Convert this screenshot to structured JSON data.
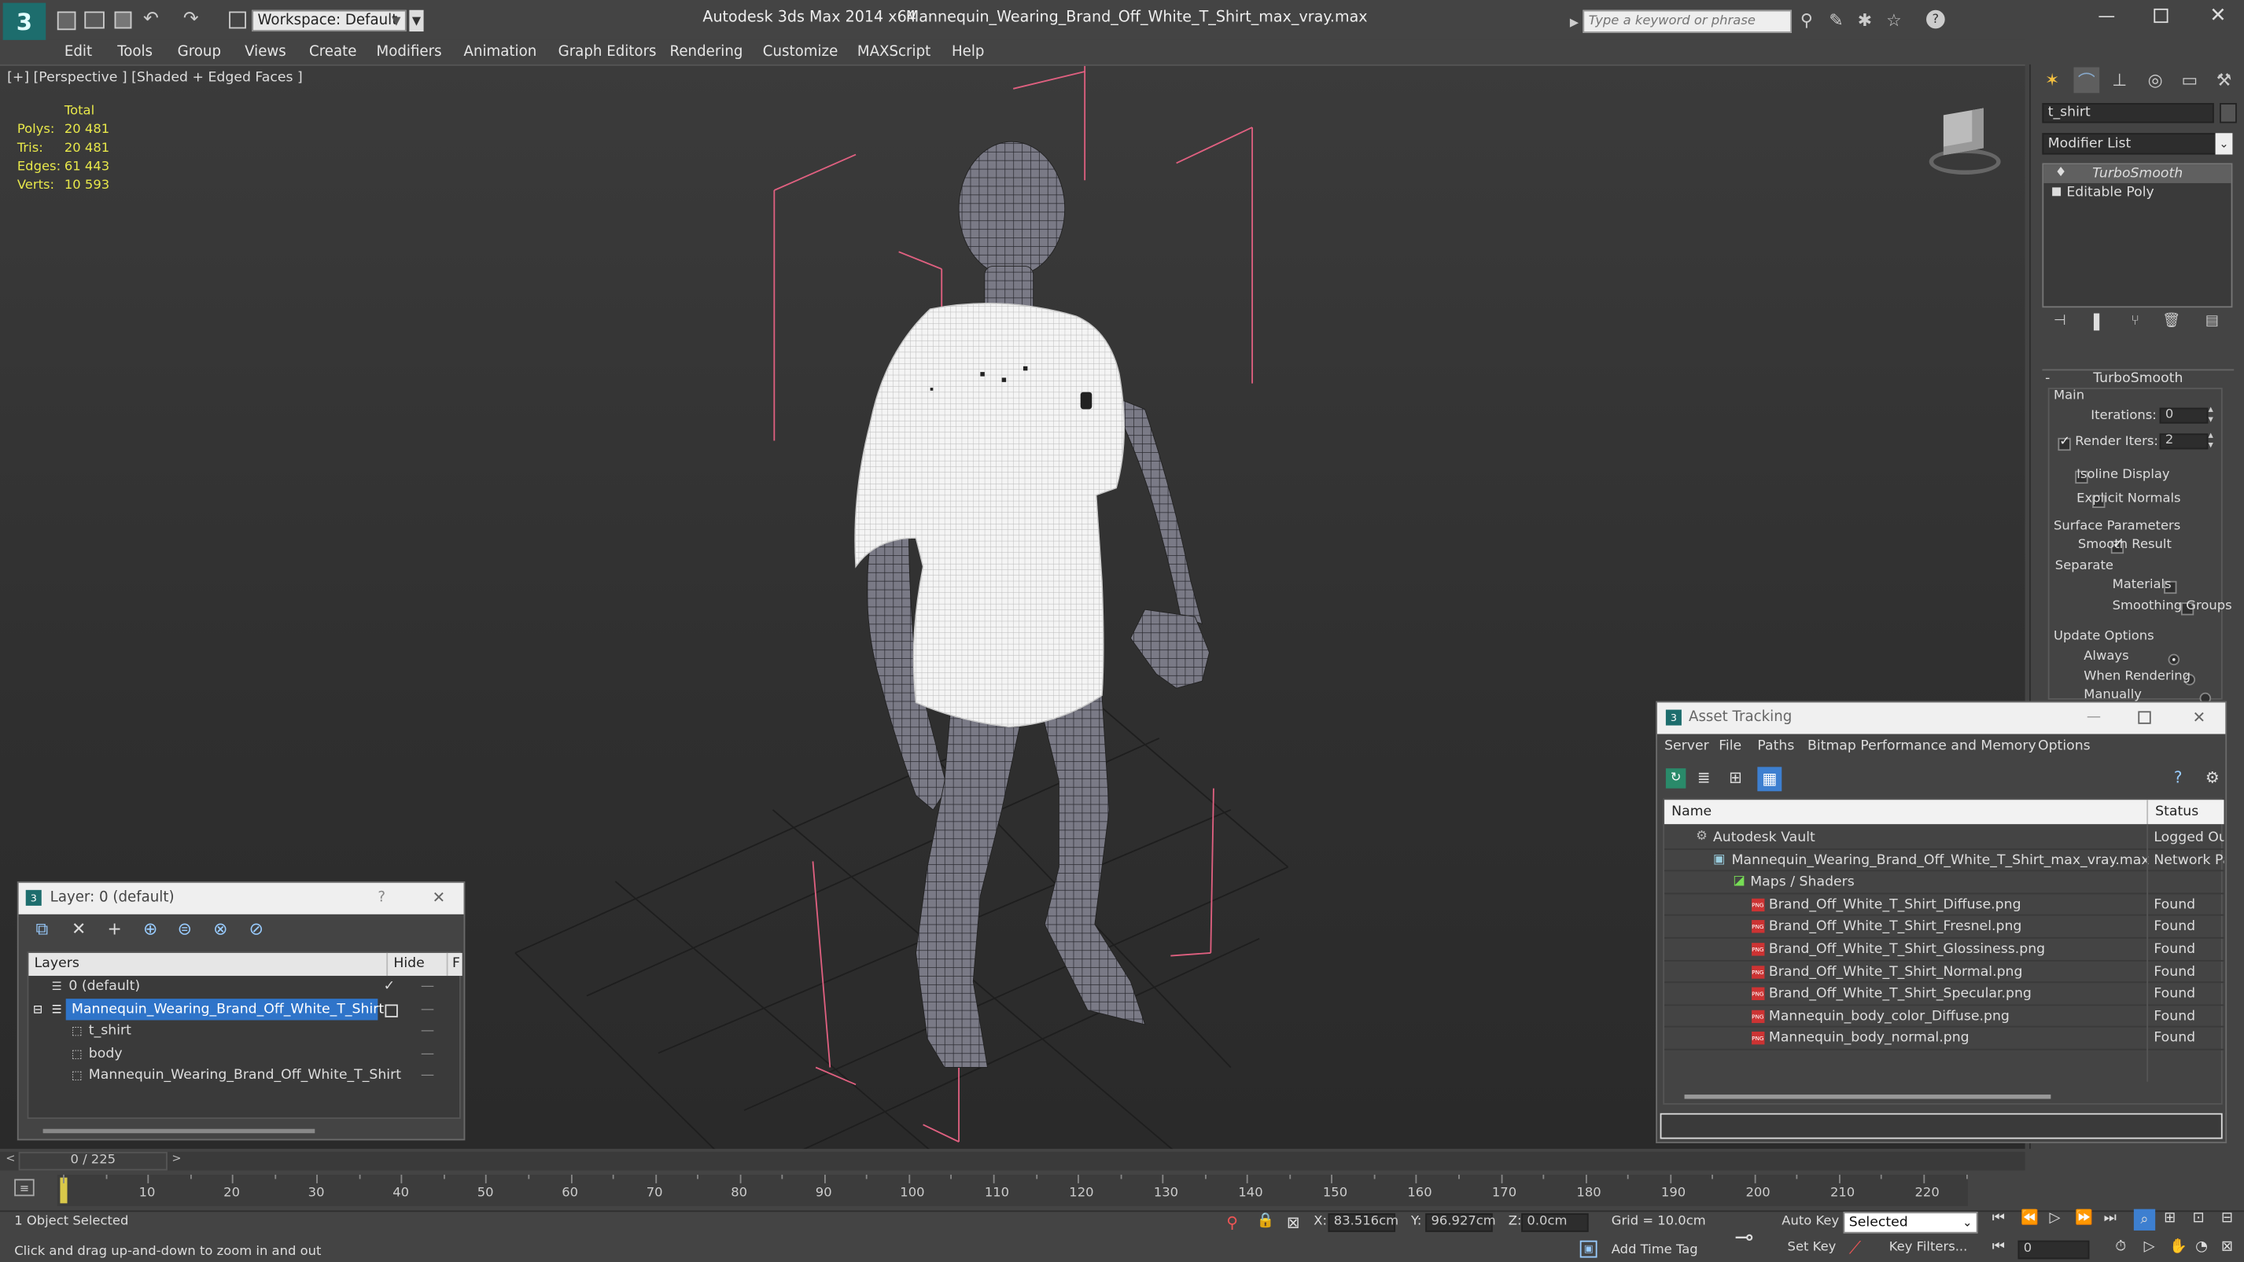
{
  "app": {
    "title": "Autodesk 3ds Max  2014 x64",
    "file": "Mannequin_Wearing_Brand_Off_White_T_Shirt_max_vray.max",
    "workspace": "Workspace: Default",
    "search_placeholder": "Type a keyword or phrase"
  },
  "menu": [
    "Edit",
    "Tools",
    "Group",
    "Views",
    "Create",
    "Modifiers",
    "Animation",
    "Graph Editors",
    "Rendering",
    "Customize",
    "MAXScript",
    "Help"
  ],
  "viewport": {
    "label": "[+] [Perspective ] [Shaded + Edged Faces ]",
    "stats": {
      "header": "Total",
      "rows": [
        {
          "label": "Polys:",
          "value": "20 481"
        },
        {
          "label": "Tris:",
          "value": "20 481"
        },
        {
          "label": "Edges:",
          "value": "61 443"
        },
        {
          "label": "Verts:",
          "value": "10 593"
        }
      ]
    }
  },
  "cmd": {
    "object_name": "t_shirt",
    "modifier_list": "Modifier List",
    "stack": [
      "TurboSmooth",
      "Editable Poly"
    ],
    "rollout_title": "TurboSmooth",
    "main": "Main",
    "iterations_label": "Iterations:",
    "iterations": "0",
    "render_iters_label": "Render Iters:",
    "render_iters": "2",
    "isoline": "Isoline Display",
    "explicit": "Explicit Normals",
    "surface": "Surface Parameters",
    "smooth": "Smooth Result",
    "separate": "Separate",
    "materials": "Materials",
    "smoothing_groups": "Smoothing Groups",
    "update": "Update Options",
    "always": "Always",
    "when_rendering": "When Rendering",
    "manually": "Manually"
  },
  "layer": {
    "title": "Layer: 0 (default)",
    "help": "?",
    "col_layers": "Layers",
    "col_hide": "Hide",
    "col_f": "F",
    "items": [
      {
        "label": "0 (default)",
        "indent": 0
      },
      {
        "label": "Mannequin_Wearing_Brand_Off_White_T_Shirt",
        "indent": 0
      },
      {
        "label": "t_shirt",
        "indent": 1
      },
      {
        "label": "body",
        "indent": 1
      },
      {
        "label": "Mannequin_Wearing_Brand_Off_White_T_Shirt",
        "indent": 1
      }
    ]
  },
  "asset": {
    "title": "Asset Tracking",
    "menu": [
      "Server",
      "File",
      "Paths",
      "Bitmap Performance and Memory",
      "Options"
    ],
    "col_name": "Name",
    "col_status": "Status",
    "rows": [
      {
        "name": "Autodesk Vault",
        "status": "Logged Ou",
        "level": 1
      },
      {
        "name": "Mannequin_Wearing_Brand_Off_White_T_Shirt_max_vray.max",
        "status": "Network Pa",
        "level": 2
      },
      {
        "name": "Maps / Shaders",
        "status": "",
        "level": 3
      },
      {
        "name": "Brand_Off_White_T_Shirt_Diffuse.png",
        "status": "Found",
        "level": 4
      },
      {
        "name": "Brand_Off_White_T_Shirt_Fresnel.png",
        "status": "Found",
        "level": 4
      },
      {
        "name": "Brand_Off_White_T_Shirt_Glossiness.png",
        "status": "Found",
        "level": 4
      },
      {
        "name": "Brand_Off_White_T_Shirt_Normal.png",
        "status": "Found",
        "level": 4
      },
      {
        "name": "Brand_Off_White_T_Shirt_Specular.png",
        "status": "Found",
        "level": 4
      },
      {
        "name": "Mannequin_body_color_Diffuse.png",
        "status": "Found",
        "level": 4
      },
      {
        "name": "Mannequin_body_normal.png",
        "status": "Found",
        "level": 4
      }
    ]
  },
  "timeline": {
    "frame": "0 / 225",
    "ticks": [
      "10",
      "20",
      "30",
      "40",
      "50",
      "60",
      "70",
      "80",
      "90",
      "100",
      "110",
      "120",
      "130",
      "140",
      "150",
      "160",
      "170",
      "180",
      "190",
      "200",
      "210",
      "220"
    ]
  },
  "status": {
    "selected": "1 Object Selected",
    "prompt": "Click and drag up-and-down to zoom in and out",
    "x_label": "X:",
    "x": "83.516cm",
    "y_label": "Y:",
    "y": "96.927cm",
    "z_label": "Z:",
    "z": "0.0cm",
    "grid": "Grid = 10.0cm",
    "add_time_tag": "Add Time Tag",
    "auto_key": "Auto Key",
    "set_key": "Set Key",
    "key_mode": "Selected",
    "key_filters": "Key Filters...",
    "current_frame": "0"
  }
}
